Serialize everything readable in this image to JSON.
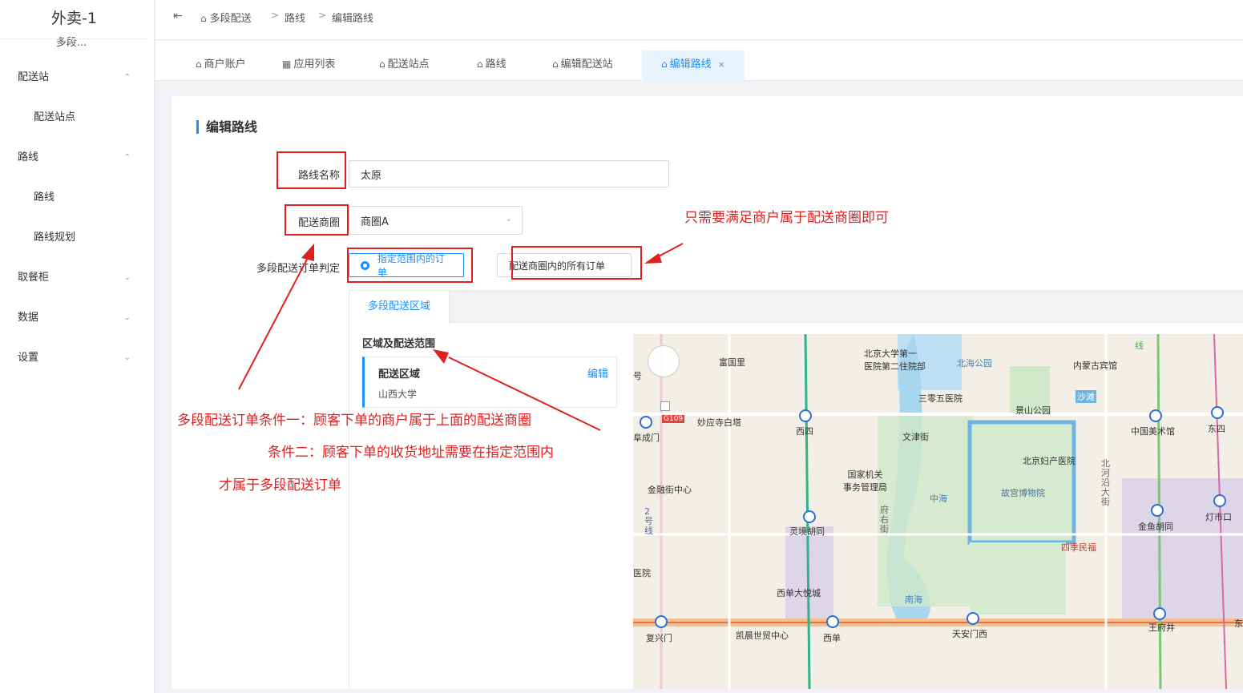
{
  "sidebar": {
    "app_title": "外卖-1",
    "app_subtitle": "多段...",
    "items": [
      {
        "label": "配送站",
        "chev": "⌃",
        "sub": false
      },
      {
        "label": "配送站点",
        "sub": true
      },
      {
        "label": "路线",
        "chev": "⌃",
        "sub": false
      },
      {
        "label": "路线",
        "sub": true
      },
      {
        "label": "路线规划",
        "sub": true
      },
      {
        "label": "取餐柜",
        "chev": "⌄",
        "sub": false
      },
      {
        "label": "数据",
        "chev": "⌄",
        "sub": false
      },
      {
        "label": "设置",
        "chev": "⌄",
        "sub": false
      }
    ]
  },
  "header": {
    "fold_icon": "⇤",
    "breadcrumb": [
      "多段配送",
      "路线",
      "编辑路线"
    ],
    "separator": ">"
  },
  "tabs": [
    {
      "label": "商户账户",
      "icon": "shop-icon"
    },
    {
      "label": "应用列表",
      "icon": "apps-icon"
    },
    {
      "label": "配送站点",
      "icon": "home-icon"
    },
    {
      "label": "路线",
      "icon": "home-icon"
    },
    {
      "label": "编辑配送站",
      "icon": "home-icon"
    },
    {
      "label": "编辑路线",
      "icon": "home-icon",
      "active": true,
      "close": "×"
    }
  ],
  "form": {
    "page_title": "编辑路线",
    "route_name_label": "路线名称",
    "route_name_value": "太原",
    "district_label": "配送商圈",
    "district_value": "商圈A",
    "order_rule_label": "多段配送订单判定",
    "option_in_range": "指定范围内的订单",
    "option_all": "配送商圈内的所有订单"
  },
  "region": {
    "tab_label": "多段配送区域",
    "section_title": "区域及配送范围",
    "card_name": "配送区域",
    "card_sub": "山西大学",
    "edit_label": "编辑"
  },
  "map": {
    "labels": {
      "fuguoli": "富国里",
      "pku_hospital": "北京大学第一\n医院第二住院部",
      "beihai": "北海公园",
      "neimenggu": "内蒙古宾馆",
      "hospital305": "三零五医院",
      "jingshan": "景山公园",
      "shatan": "沙滩",
      "miaoying": "妙应寺白塔",
      "xisi": "西四",
      "wenjin": "文津街",
      "art_museum": "中国美术馆",
      "dongsi": "东四",
      "g109": "G109",
      "chengmen": "阜成门",
      "guojia": "国家机关\n事务管理局",
      "fuchan": "北京妇产医院",
      "jinrong": "金融街中心",
      "zhonghai": "中海",
      "palace": "故宫博物院",
      "beiheyan": "北\n河\n沿\n大\n街",
      "dengshikou": "灯市口",
      "lingjing": "灵境胡同",
      "fuyoujie": "府\n右\n街",
      "jinyu": "金鱼胡同",
      "siji": "四季民福",
      "line2": "2\n号\n线",
      "hospital": "医院",
      "xidan_joy": "西单大悦城",
      "nanhai": "南海",
      "fuxingmen": "复兴门",
      "kaichen": "凯晨世贸中心",
      "xidan": "西单",
      "tiananmen_w": "天安门西",
      "wangfujing": "王府井",
      "dong": "东",
      "hao": "号",
      "xian": "线"
    }
  },
  "annotations": {
    "note_right": "只需要满足商户属于配送商圈即可",
    "note_cond1": "多段配送订单条件一：顾客下单的商户属于上面的配送商圈",
    "note_cond2": "条件二：顾客下单的收货地址需要在指定范围内",
    "note_cond3": "才属于多段配送订单"
  },
  "colors": {
    "accent": "#1890ff",
    "annotation": "#e02020"
  }
}
